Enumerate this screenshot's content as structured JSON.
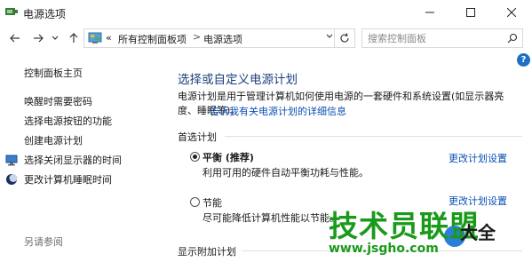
{
  "window": {
    "title": "电源选项",
    "controls": [
      "minimize-icon",
      "maximize-icon",
      "close-icon"
    ]
  },
  "address": {
    "nav_icons": [
      "back-arrow-icon",
      "forward-arrow-icon",
      "recent-dropdown-icon",
      "up-arrow-icon"
    ],
    "overflow": "«",
    "breadcrumbs": [
      "所有控制面板项",
      "电源选项"
    ],
    "separator": ">",
    "search_placeholder": "搜索控制面板"
  },
  "sidebar": {
    "home": "控制面板主页",
    "items": [
      {
        "label": "唤醒时需要密码"
      },
      {
        "label": "选择电源按钮的功能"
      },
      {
        "label": "创建电源计划"
      },
      {
        "label": "选择关闭显示器的时间",
        "icon": "display-icon"
      },
      {
        "label": "更改计算机睡眠时间",
        "icon": "moon-sleep-icon"
      }
    ],
    "see_also": "另请参阅"
  },
  "main": {
    "help": "?",
    "title": "选择或自定义电源计划",
    "description": "电源计划是用于管理计算机如何使用电源的一套硬件和系统设置(如显示器亮度、睡眠等)。",
    "description_link": "告诉我有关电源计划的详细信息",
    "preferred_label": "首选计划",
    "plans": [
      {
        "name": "平衡 (推荐)",
        "desc": "利用可用的硬件自动平衡功耗与性能。",
        "link": "更改计划设置",
        "selected": true
      },
      {
        "name": "节能",
        "desc": "尽可能降低计算机性能以节能。",
        "link": "更改计划设置",
        "selected": false
      }
    ],
    "additional_label": "显示附加计划"
  },
  "watermark": {
    "main": "技术员联盟",
    "url": "www.jsgho.com",
    "extra": "大全"
  },
  "colors": {
    "title_blue": "#1d3f7a",
    "link_blue": "#0a4fb6",
    "watermark_green": "#1a9a1a"
  }
}
